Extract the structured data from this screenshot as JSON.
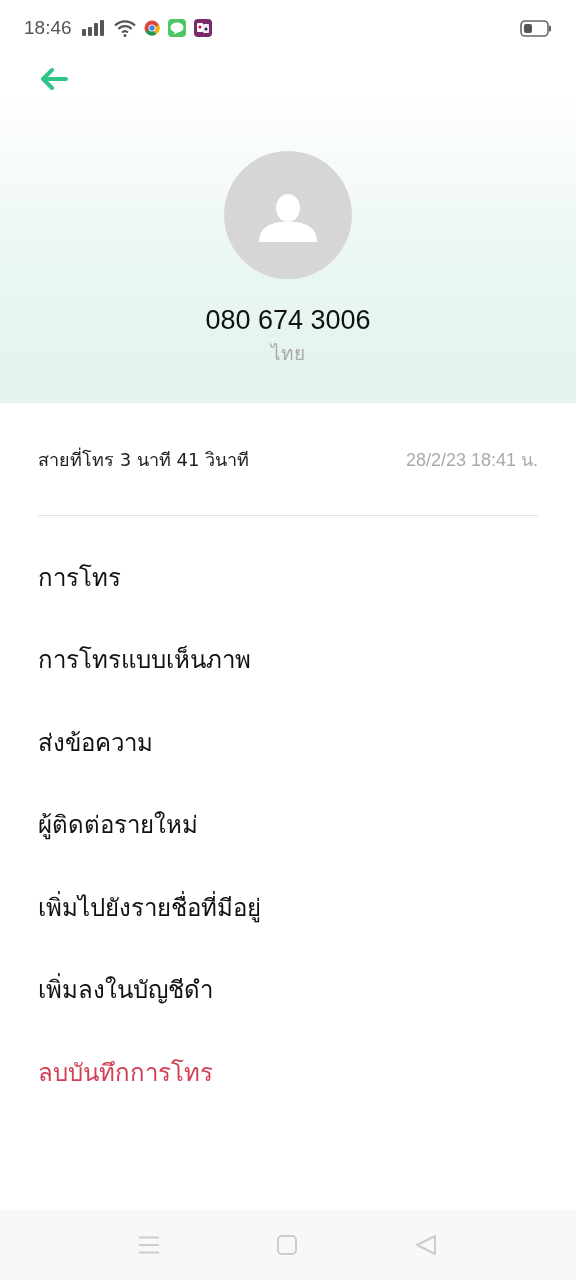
{
  "status_bar": {
    "time": "18:46"
  },
  "contact": {
    "number": "080 674 3006",
    "location": "ไทย"
  },
  "call_log": {
    "summary": "สายที่โทร  3  นาที 41 วินาที",
    "timestamp": "28/2/23 18:41 น."
  },
  "actions": [
    {
      "label": "การโทร",
      "kind": "normal"
    },
    {
      "label": "การโทรแบบเห็นภาพ",
      "kind": "normal"
    },
    {
      "label": "ส่งข้อความ",
      "kind": "normal"
    },
    {
      "label": "ผู้ติดต่อรายใหม่",
      "kind": "normal"
    },
    {
      "label": "เพิ่มไปยังรายชื่อที่มีอยู่",
      "kind": "normal"
    },
    {
      "label": "เพิ่มลงในบัญชีดำ",
      "kind": "normal"
    },
    {
      "label": "ลบบันทึกการโทร",
      "kind": "danger"
    }
  ]
}
